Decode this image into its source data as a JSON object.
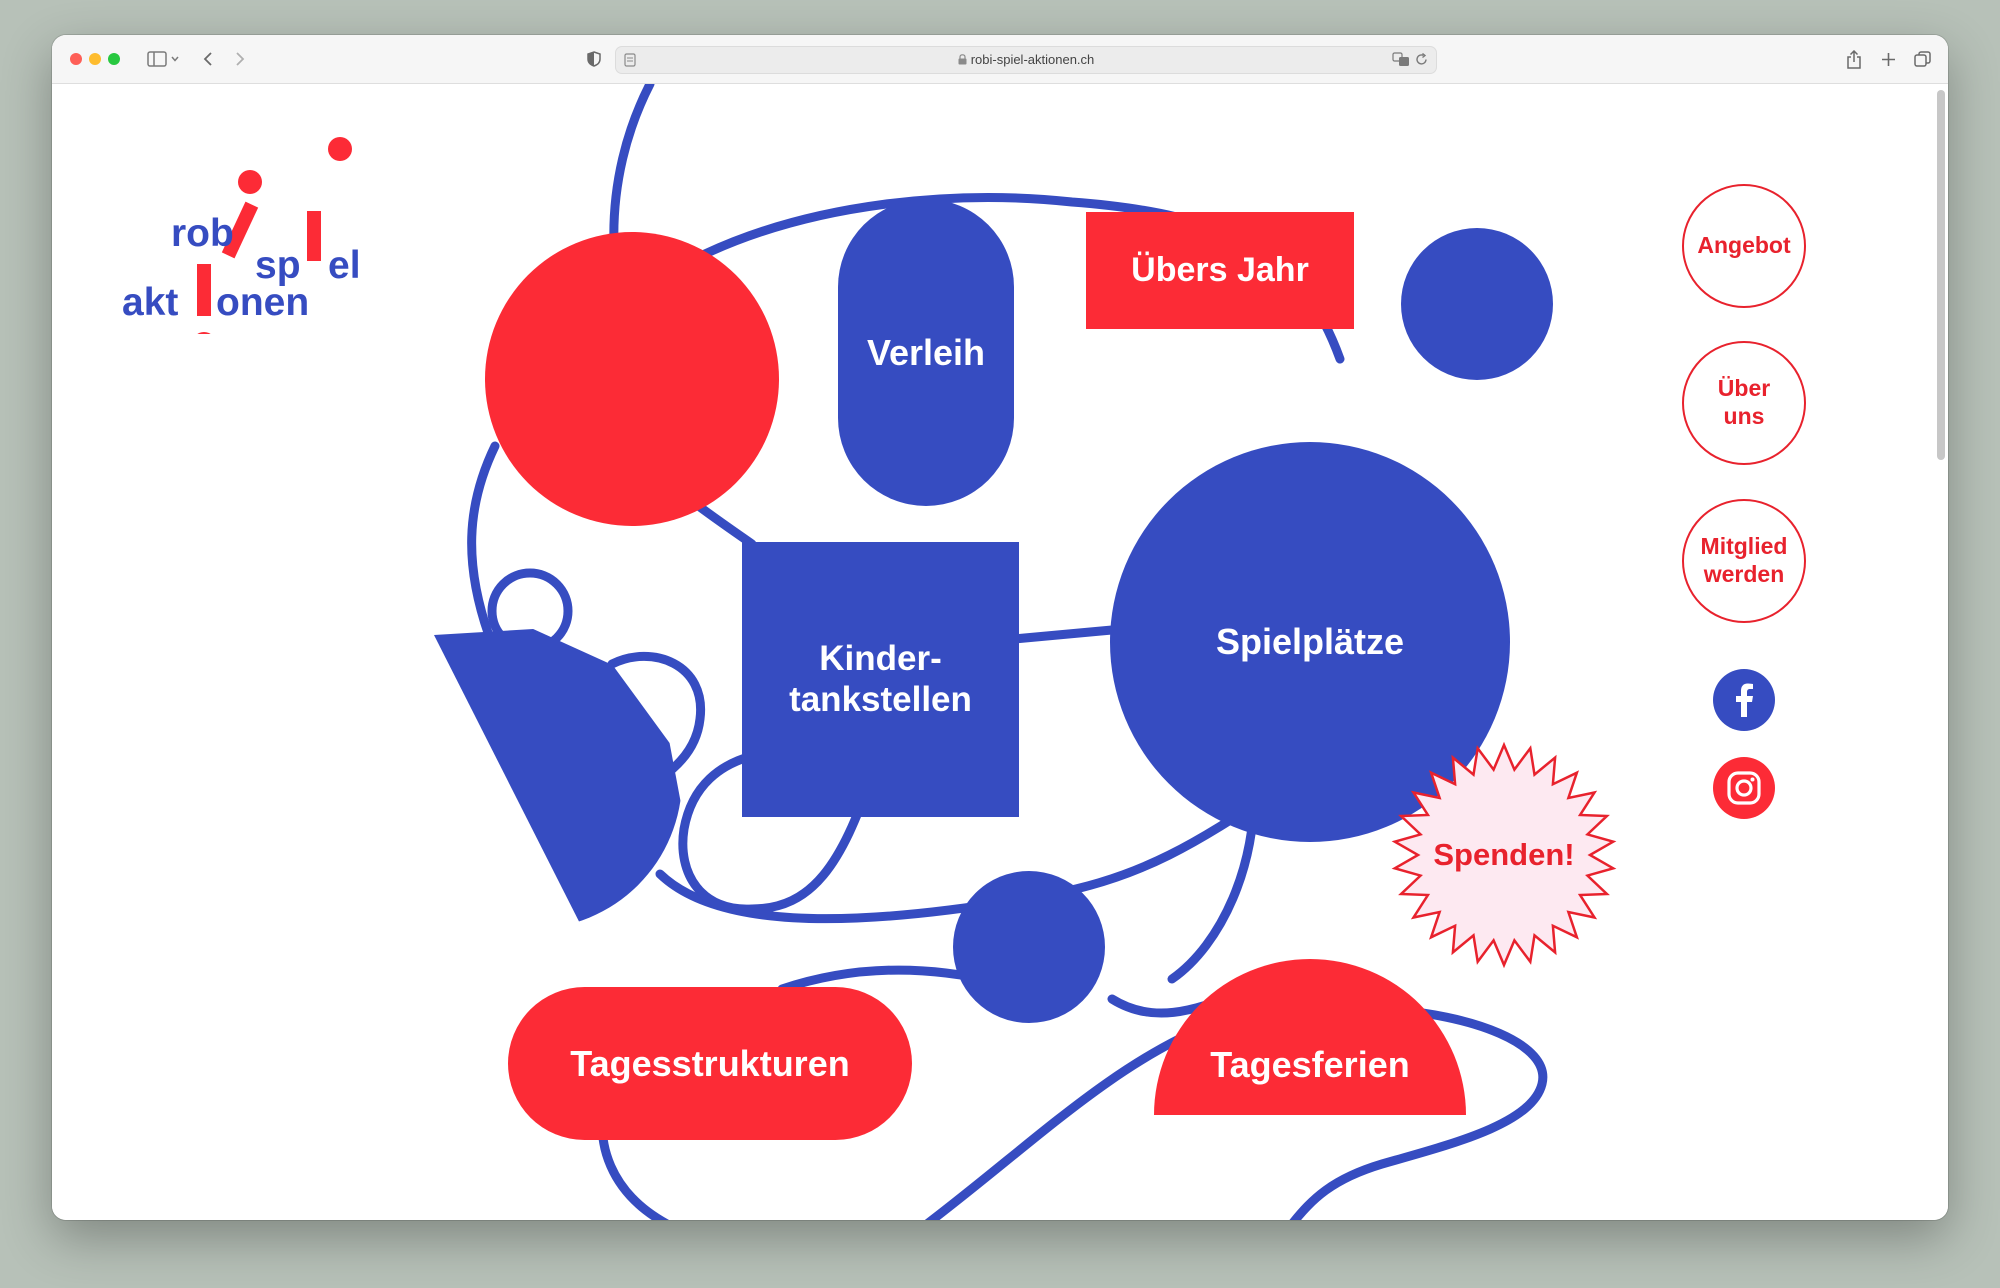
{
  "browser": {
    "url": "robi-spiel-aktionen.ch"
  },
  "logo": {
    "line1_a": "rob",
    "line1_b": "sp",
    "line1_c": "el",
    "line2_a": "akt",
    "line2_b": "onen"
  },
  "tiles": {
    "verleih": "Verleih",
    "uebers_jahr": "Übers Jahr",
    "kinder_line1": "Kinder-",
    "kinder_line2": "tankstellen",
    "spielplaetze": "Spielplätze",
    "spenden": "Spenden!",
    "tagesstrukturen": "Tagesstrukturen",
    "tagesferien": "Tagesferien"
  },
  "nav": {
    "angebot": "Angebot",
    "ueber_line1": "Über",
    "ueber_line2": "uns",
    "mitglied_line1": "Mitglied",
    "mitglied_line2": "werden"
  },
  "icons": {
    "facebook": "facebook-icon",
    "instagram": "instagram-icon"
  },
  "colors": {
    "blue": "#364cc1",
    "red": "#fc2b36",
    "spenden_fill": "#fde9f1"
  }
}
